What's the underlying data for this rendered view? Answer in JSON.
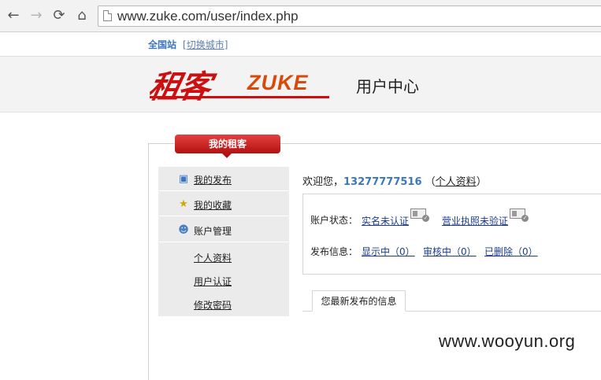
{
  "browser": {
    "url": "www.zuke.com/user/index.php",
    "back_icon": "arrow-left",
    "forward_icon": "arrow-right",
    "reload_icon": "reload",
    "home_icon": "home"
  },
  "citybar": {
    "city": "全国站",
    "switch_label": "切换城市"
  },
  "header": {
    "logo_cn": "租客",
    "logo_en": "ZUKE",
    "title": "用户中心"
  },
  "panel": {
    "tab_label": "我的租客"
  },
  "sidebar": {
    "items": [
      {
        "label": "我的发布",
        "icon": "speech-bubble"
      },
      {
        "label": "我的收藏",
        "icon": "star"
      },
      {
        "label": "账户管理",
        "icon": "user"
      }
    ],
    "sub_items": [
      {
        "label": "个人资料"
      },
      {
        "label": "用户认证"
      },
      {
        "label": "修改密码"
      }
    ]
  },
  "welcome": {
    "prefix": "欢迎您，",
    "phone": "13277777516",
    "open_paren": "（",
    "profile_link": "个人资料",
    "close_paren": "）"
  },
  "account": {
    "status_label": "账户状态：",
    "realname": "实名未认证",
    "license": "营业执照未验证",
    "publish_label": "发布信息：",
    "showing": "显示中（0）",
    "reviewing": "审核中（0）",
    "deleted": "已删除（0）"
  },
  "recent": {
    "tab_label": "您最新发布的信息"
  },
  "watermark": "www.wooyun.org",
  "colors": {
    "brand_red": "#cc1010",
    "link_blue": "#3a76c3"
  }
}
